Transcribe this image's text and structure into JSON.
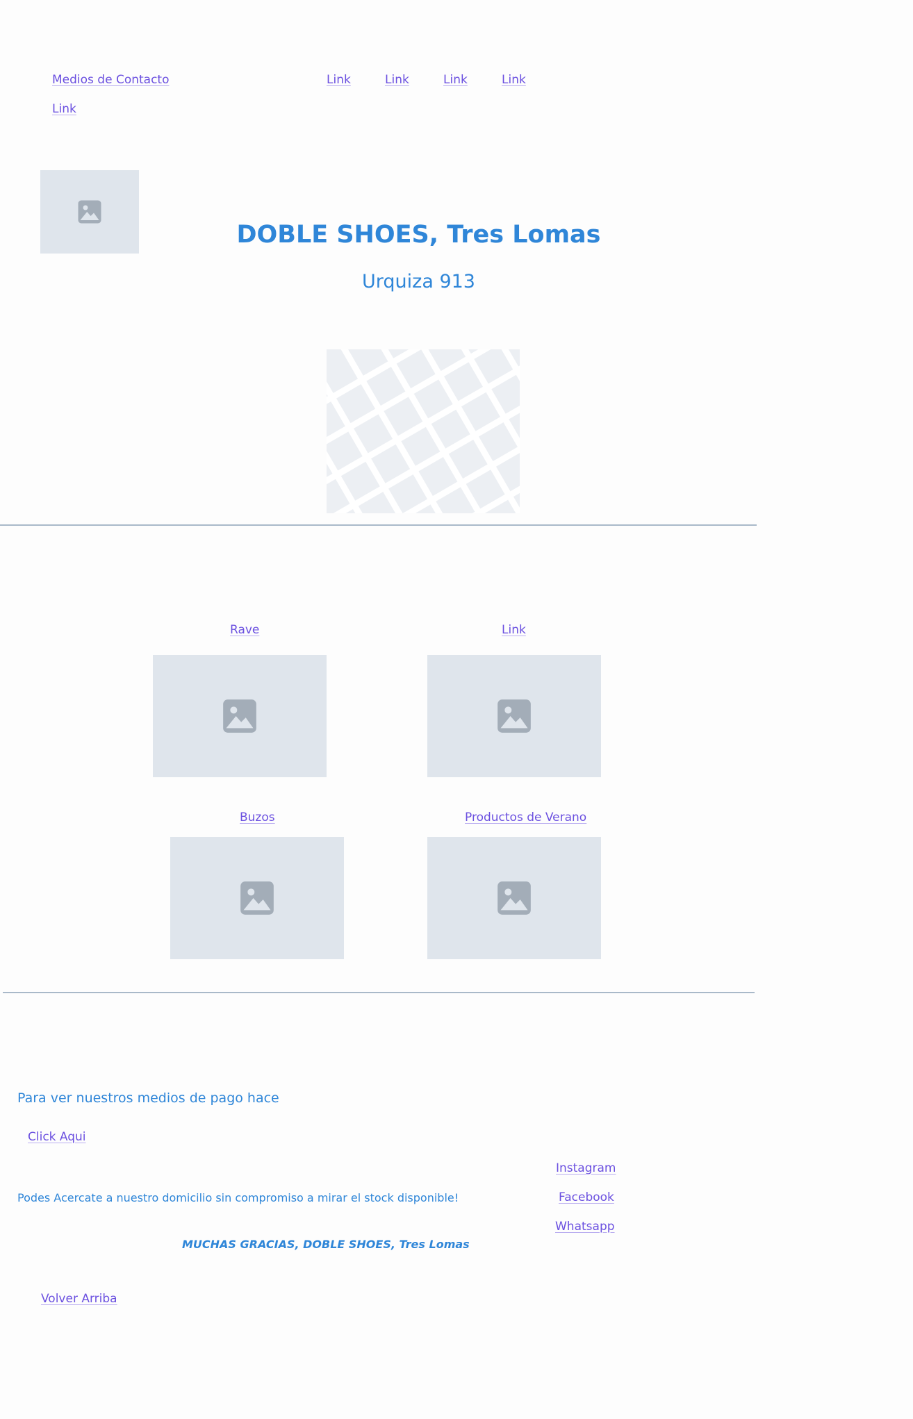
{
  "nav": {
    "contact_link": "Medios de Contacto",
    "links": [
      "Link",
      "Link",
      "Link",
      "Link"
    ],
    "extra_link": "Link"
  },
  "header": {
    "title": "DOBLE SHOES, Tres Lomas",
    "address": "Urquiza 913"
  },
  "gallery": {
    "items": [
      {
        "label": "Rave"
      },
      {
        "label": "Link"
      },
      {
        "label": "Buzos"
      },
      {
        "label": "Productos de Verano"
      }
    ]
  },
  "footer": {
    "payment_text": "Para ver nuestros medios de pago hace",
    "click_here": "Click Aqui",
    "visit_text": "Podes Acercate a nuestro domicilio sin compromiso a mirar el stock disponible!",
    "thanks": "MUCHAS GRACIAS, DOBLE SHOES, Tres Lomas",
    "back_to_top": "Volver Arriba",
    "social": {
      "instagram": "Instagram",
      "facebook": "Facebook",
      "whatsapp": "Whatsapp"
    }
  },
  "colors": {
    "link": "#6b50e0",
    "heading": "#2f86d8",
    "placeholder": "#dfe5ec",
    "placeholder_icon": "#a3adb8",
    "divider": "#a9b9c9"
  }
}
